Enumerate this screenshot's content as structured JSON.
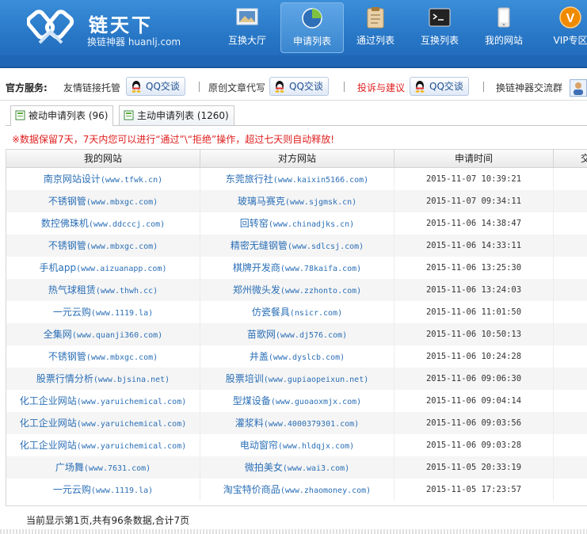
{
  "header": {
    "logo_title": "链天下",
    "logo_subtitle": "换链神器 huanlj.com",
    "nav": [
      {
        "label": "互换大厅",
        "icon": "monitor-landscape-icon",
        "active": false
      },
      {
        "label": "申请列表",
        "icon": "pie-chart-icon",
        "active": true
      },
      {
        "label": "通过列表",
        "icon": "clipboard-icon",
        "active": false
      },
      {
        "label": "互换列表",
        "icon": "terminal-screen-icon",
        "active": false
      },
      {
        "label": "我的网站",
        "icon": "phone-device-icon",
        "active": false
      },
      {
        "label": "VIP专区",
        "icon": "vip-badge-icon",
        "active": false
      }
    ],
    "colors": {
      "bg": "#2776c6",
      "vip": "#f08a00"
    }
  },
  "services": {
    "title": "官方服务:",
    "items": [
      {
        "label": "友情链接托管",
        "button": "QQ交谈",
        "highlight": false
      },
      {
        "label": "原创文章代写",
        "button": "QQ交谈",
        "highlight": false
      },
      {
        "label": "投诉与建议",
        "button": "QQ交谈",
        "highlight": true
      },
      {
        "label": "换链神器交流群",
        "button": "",
        "highlight": false
      }
    ]
  },
  "tabs": [
    {
      "label": "被动申请列表 (96)",
      "active": true
    },
    {
      "label": "主动申请列表 (1260)",
      "active": false
    }
  ],
  "notice": "※数据保留7天，7天内您可以进行“通过”\\“拒绝”操作，超过七天则自动释放!",
  "table": {
    "headers": [
      "我的网站",
      "对方网站",
      "申请时间",
      "交"
    ],
    "rows": [
      {
        "my_name": "南京网站设计",
        "my_url": "(www.tfwk.cn)",
        "their_name": "东莞旅行社",
        "their_url": "(www.kaixin5166.com)",
        "time": "2015-11-07 10:39:21"
      },
      {
        "my_name": "不锈钢管",
        "my_url": "(www.mbxgc.com)",
        "their_name": "玻璃马赛克",
        "their_url": "(www.sjgmsk.cn)",
        "time": "2015-11-07 09:34:11"
      },
      {
        "my_name": "数控佛珠机",
        "my_url": "(www.ddcccj.com)",
        "their_name": "回转窑",
        "their_url": "(www.chinadjks.cn)",
        "time": "2015-11-06 14:38:47"
      },
      {
        "my_name": "不锈钢管",
        "my_url": "(www.mbxgc.com)",
        "their_name": "精密无缝钢管",
        "their_url": "(www.sdlcsj.com)",
        "time": "2015-11-06 14:33:11"
      },
      {
        "my_name": "手机app",
        "my_url": "(www.aizuanapp.com)",
        "their_name": "棋牌开发商",
        "their_url": "(www.78kaifa.com)",
        "time": "2015-11-06 13:25:30"
      },
      {
        "my_name": "热气球租赁",
        "my_url": "(www.thwh.cc)",
        "their_name": "郑州微头发",
        "their_url": "(www.zzhonto.com)",
        "time": "2015-11-06 13:24:03"
      },
      {
        "my_name": "一元云购",
        "my_url": "(www.1119.la)",
        "their_name": "仿瓷餐具",
        "their_url": "(nsicr.com)",
        "time": "2015-11-06 11:01:50"
      },
      {
        "my_name": "全集网",
        "my_url": "(www.quanji360.com)",
        "their_name": "苗歌网",
        "their_url": "(www.dj576.com)",
        "time": "2015-11-06 10:50:13"
      },
      {
        "my_name": "不锈钢管",
        "my_url": "(www.mbxgc.com)",
        "their_name": "井盖",
        "their_url": "(www.dyslcb.com)",
        "time": "2015-11-06 10:24:28"
      },
      {
        "my_name": "股票行情分析",
        "my_url": "(www.bjsina.net)",
        "their_name": "股票培训",
        "their_url": "(www.gupiaopeixun.net)",
        "time": "2015-11-06 09:06:30"
      },
      {
        "my_name": "化工企业网站",
        "my_url": "(www.yaruichemical.com)",
        "their_name": "型煤设备",
        "their_url": "(www.guoaoxmjx.com)",
        "time": "2015-11-06 09:04:14"
      },
      {
        "my_name": "化工企业网站",
        "my_url": "(www.yaruichemical.com)",
        "their_name": "灌浆料",
        "their_url": "(www.4000379301.com)",
        "time": "2015-11-06 09:03:56"
      },
      {
        "my_name": "化工企业网站",
        "my_url": "(www.yaruichemical.com)",
        "their_name": "电动窗帘",
        "their_url": "(www.hldqjx.com)",
        "time": "2015-11-06 09:03:28"
      },
      {
        "my_name": "广场舞",
        "my_url": "(www.7631.com)",
        "their_name": "微拍美女",
        "their_url": "(www.wai3.com)",
        "time": "2015-11-05 20:33:19"
      },
      {
        "my_name": "一元云购",
        "my_url": "(www.1119.la)",
        "their_name": "淘宝特价商品",
        "their_url": "(www.zhaomoney.com)",
        "time": "2015-11-05 17:23:57"
      }
    ]
  },
  "footer": "当前显示第1页,共有96条数据,合计7页"
}
